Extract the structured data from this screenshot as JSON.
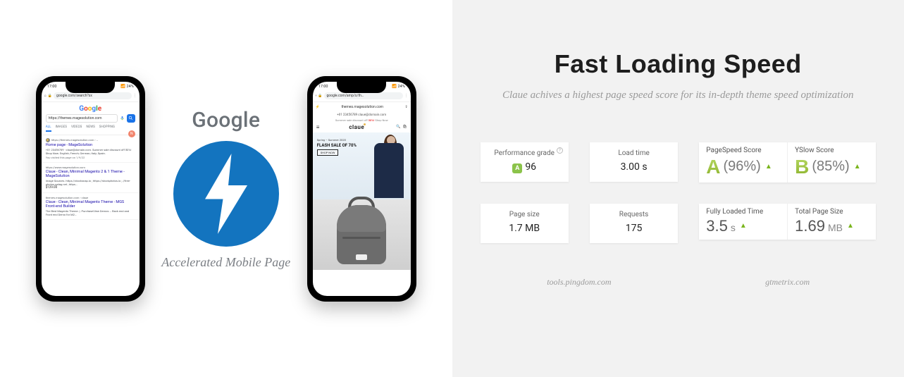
{
  "left": {
    "google_label": "Google",
    "amp_caption": "Accelerated Mobile Page",
    "phone1": {
      "time": "17:00",
      "battery": "24%",
      "url": "google.com/search?sx",
      "search_value": "https://themes.magesolution.com",
      "avatar_letter": "N",
      "tabs": [
        "ALL",
        "IMAGES",
        "VIDEOS",
        "NEWS",
        "SHOPPING"
      ],
      "results": [
        {
          "bc": "https://themes.magesolution.com › …",
          "title": "Home page - MageSolution",
          "desc": "+01 23456789 · claue@domain.com. Summer sale discount off 50%! Shop Now. English; French; German; Italy; Spain.",
          "visited": "You visited this page on 1/9/22"
        },
        {
          "bc": "https://www.magesolution.com",
          "title": "Claue - Clean, Minimal Magento 2 & 1 Theme - MageSolution",
          "desc": "Image Sources. https://stocksnap.io ; https://stockphotos.io ; //free-photos.gatag.net ; https…",
          "price": "$129.00"
        },
        {
          "bc": "themes.magesolution.com › claue",
          "title": "Claue - Clean, Minimal Magento Theme - MGS Front-end Builder",
          "desc": "The Best Magento Theme. |. PurchaseView Demos … Back end and Front end Demo for M2…"
        }
      ]
    },
    "phone2": {
      "time": "17:00",
      "battery": "24%",
      "url": "google.com/amp/s/th…",
      "amp_url": "themes.magesolution.com",
      "topbar": "+01 23456789   claue@domain.com",
      "promo_pre": "Summer sale discount off ",
      "promo_off": "50%!",
      "promo_post": " Shop Now",
      "brand": "claue",
      "hero_season": "Spring – Summer 2020",
      "hero_title": "FLASH SALE OF 70%",
      "hero_cta": "SHOP NOW"
    }
  },
  "right": {
    "headline": "Fast Loading Speed",
    "subhead": "Claue achives a highest page speed score for its in-depth theme speed optimization",
    "pingdom": {
      "perf_label": "Performance grade",
      "perf_value": "96",
      "load_label": "Load time",
      "load_value": "3.00 s",
      "size_label": "Page size",
      "size_value": "1.7 MB",
      "req_label": "Requests",
      "req_value": "175",
      "source": "tools.pingdom.com"
    },
    "gtmetrix": {
      "ps_label": "PageSpeed Score",
      "ps_grade": "A",
      "ps_pct": "(96%)",
      "ys_label": "YSlow Score",
      "ys_grade": "B",
      "ys_pct": "(85%)",
      "flt_label": "Fully Loaded Time",
      "flt_val": "3.5",
      "flt_unit": "s",
      "tps_label": "Total Page Size",
      "tps_val": "1.69",
      "tps_unit": "MB",
      "source": "gtmetrix.com"
    }
  }
}
